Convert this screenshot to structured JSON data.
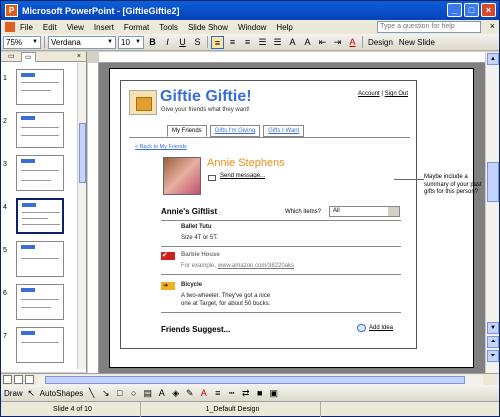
{
  "window": {
    "title": "Microsoft PowerPoint - [GiftieGiftie2]"
  },
  "menu": {
    "items": [
      "File",
      "Edit",
      "View",
      "Insert",
      "Format",
      "Tools",
      "Slide Show",
      "Window",
      "Help"
    ],
    "help_placeholder": "Type a question for help"
  },
  "toolbar": {
    "zoom": "75%",
    "font": "Verdana",
    "size": "10",
    "bold": "B",
    "italic": "I",
    "underline": "U",
    "shadow": "S",
    "design_label": "Design",
    "new_slide_label": "New Slide"
  },
  "slides_pane": {
    "numbers": [
      "1",
      "2",
      "3",
      "4",
      "5",
      "6",
      "7"
    ],
    "selected": "4"
  },
  "mockup": {
    "app_title": "Giftie Giftie!",
    "tagline": "Give your friends what they want!",
    "account_link": "Account",
    "signout_link": "Sign Out",
    "tabs": [
      "My Friends",
      "Gifts I'm Giving",
      "Gifts I Want"
    ],
    "back_link": "< Back to My Friends",
    "person_name": "Annie Stephens",
    "send_message": "Send message...",
    "giftlist_title": "Annie's Giftlist",
    "which_label": "Which items?",
    "which_value": "All",
    "items": [
      {
        "title": "Ballet Tutu",
        "desc": "Size 4T or 5T."
      },
      {
        "title": "Barbie House",
        "desc_prefix": "For example, ",
        "desc_link": "www.amazon.com/38220aks"
      },
      {
        "title": "Bicycle",
        "desc_line1": "A two-wheeler. They've got a nice",
        "desc_line2": "one at Target, for about 50 bucks."
      }
    ],
    "suggest_title": "Friends Suggest...",
    "add_idea": "Add Idea"
  },
  "note": {
    "text": "Maybe include a summary of your past gifts for this person?"
  },
  "drawbar": {
    "draw_label": "Draw",
    "autoshapes_label": "AutoShapes"
  },
  "status": {
    "slide": "Slide 4 of 10",
    "design": "1_Default Design"
  }
}
